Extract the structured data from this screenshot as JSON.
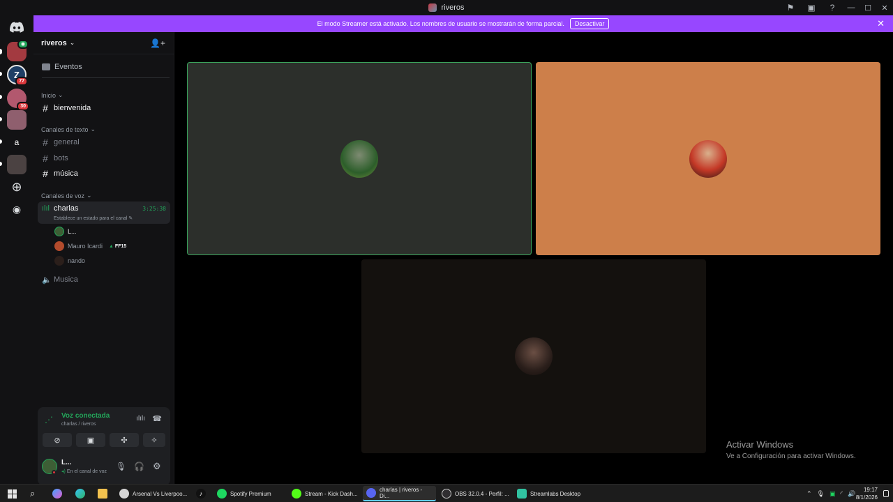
{
  "window": {
    "title": "riveros"
  },
  "banner": {
    "text": "El modo Streamer está activado. Los nombres de usuario se mostrarán de forma parcial.",
    "button": "Desactivar"
  },
  "rail": {
    "home_icon": "discord-icon",
    "servers": [
      {
        "name": "server-riveros",
        "badge": "",
        "color": "#a33a40"
      },
      {
        "name": "server-z",
        "badge": "77",
        "color": "#1f3f66"
      },
      {
        "name": "server-3",
        "badge": "30",
        "color": "#b2586e"
      },
      {
        "name": "server-4",
        "badge": "",
        "color": "#8f5f6e"
      },
      {
        "name": "server-a",
        "badge": "",
        "letter": "a",
        "color": "#121214"
      },
      {
        "name": "server-6",
        "badge": "",
        "color": "#4b4242"
      }
    ]
  },
  "sidebar": {
    "server_name": "riveros",
    "events": "Eventos",
    "categories": {
      "inicio": "Inicio",
      "texto": "Canales de texto",
      "voz": "Canales de voz"
    },
    "channels": {
      "bienvenida": "bienvenida",
      "general": "general",
      "bots": "bots",
      "musica": "música",
      "musica_voice": "Musica"
    },
    "voice_channel": {
      "name": "charlas",
      "timer": "3:25:38",
      "status": "Establece un estado para el canal"
    },
    "voice_users": [
      {
        "name": "L...",
        "tag": ""
      },
      {
        "name": "Mauro Icardi",
        "tag": "FF15"
      },
      {
        "name": "nando",
        "tag": ""
      }
    ]
  },
  "voice_panel": {
    "status": "Voz conectada",
    "location": "charlas / riveros"
  },
  "user_panel": {
    "name": "L...",
    "status": "En el canal de voz"
  },
  "stage": {
    "tiles": [
      {
        "name": "tile-user-1",
        "bg": "#2c2f2b",
        "border": "#3ba55c"
      },
      {
        "name": "tile-user-2",
        "bg": "#cd7f4a",
        "border": ""
      },
      {
        "name": "tile-user-3",
        "bg": "#14110e",
        "border": ""
      }
    ]
  },
  "watermark": {
    "title": "Activar Windows",
    "subtitle": "Ve a Configuración para activar Windows."
  },
  "taskbar": {
    "apps": [
      {
        "label": "Arsenal Vs Liverpoo...",
        "color": "#d5d5d5",
        "active": false
      },
      {
        "label": "Spotify Premium",
        "color": "#1ed760",
        "active": false
      },
      {
        "label": "Stream - Kick Dash...",
        "color": "#53fc18",
        "active": false
      },
      {
        "label": "charlas | riveros - Di...",
        "color": "#5865f2",
        "active": true
      },
      {
        "label": "OBS 32.0.4 - Perfil: ...",
        "color": "#302e31",
        "active": false
      },
      {
        "label": "Streamlabs Desktop",
        "color": "#31c3a2",
        "active": false
      }
    ],
    "time": "19:17",
    "date": "8/1/2026"
  }
}
